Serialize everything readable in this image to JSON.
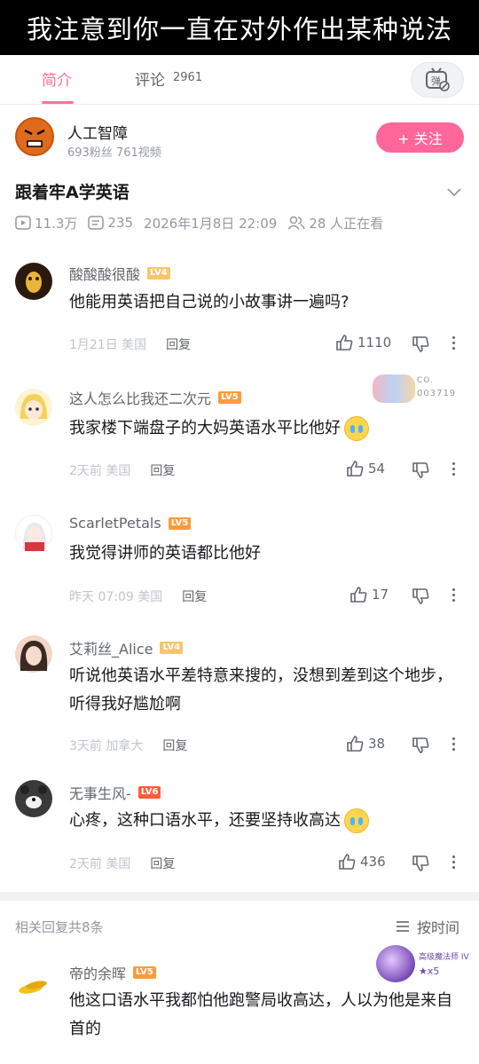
{
  "caption": "我注意到你一直在对外作出某种说法",
  "tabs": {
    "intro": "简介",
    "comments": "评论",
    "comment_count": "2961"
  },
  "danmaku_label": "弹",
  "uploader": {
    "name": "人工智障",
    "stats": "693粉丝  761视频",
    "follow": "+ 关注"
  },
  "video": {
    "title": "跟着牢A学英语",
    "views": "11.3万",
    "danmaku": "235",
    "datetime": "2026年1月8日 22:09",
    "watching": "28 人正在看"
  },
  "comments": [
    {
      "name": "酸酸酸很酸",
      "level": "LV4",
      "text": "他能用英语把自己说的小故事讲一遍吗?",
      "time": "1月21日 美国",
      "reply": "回复",
      "likes": "1110"
    },
    {
      "name": "这人怎么比我还二次元",
      "level": "LV5",
      "text": "我家楼下端盘子的大妈英语水平比他好",
      "time": "2天前 美国",
      "reply": "回复",
      "likes": "54",
      "badge": {
        "line1": "CO.",
        "line2": "003719"
      }
    },
    {
      "name": "ScarletPetals",
      "level": "LV5",
      "text": "我觉得讲师的英语都比他好",
      "time": "昨天 07:09 美国",
      "reply": "回复",
      "likes": "17"
    },
    {
      "name": "艾莉丝_Alice",
      "level": "LV4",
      "text": "听说他英语水平差特意来搜的，没想到差到这个地步，听得我好尴尬啊",
      "time": "3天前 加拿大",
      "reply": "回复",
      "likes": "38"
    },
    {
      "name": "无事生风-",
      "level": "LV6",
      "text": "心疼，这种口语水平，还要坚持收高达",
      "time": "2天前 美国",
      "reply": "回复",
      "likes": "436"
    }
  ],
  "related": {
    "count_text": "相关回复共8条",
    "sort": "按时间"
  },
  "reply": {
    "name": "帝的余晖",
    "level": "LV5",
    "text": "他这口语水平我都怕他跑警局收高达，人以为他是来自首的",
    "badge": {
      "line1": "高级魔法师 IV",
      "line2": "★x5"
    }
  },
  "colors": {
    "accent": "#fb7299",
    "follow_bg": "#ff6699",
    "text_primary": "#18191c",
    "text_secondary": "#9499a0"
  }
}
